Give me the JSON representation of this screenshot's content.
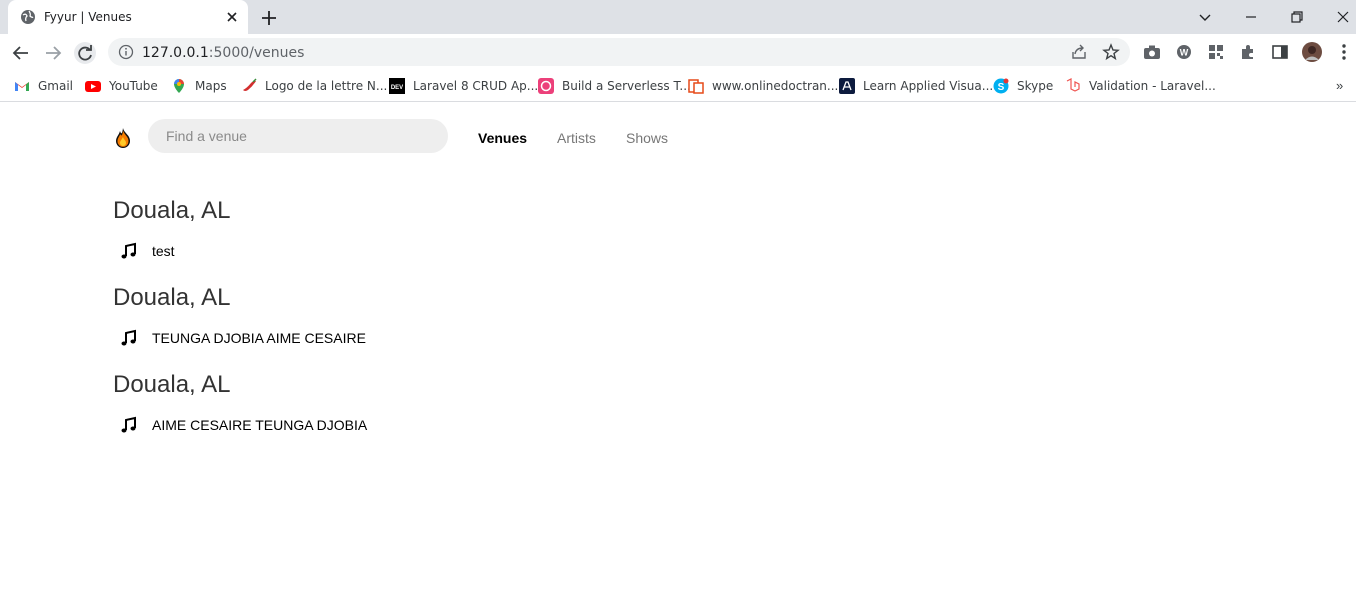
{
  "browser": {
    "tab": {
      "title": "Fyyur | Venues"
    },
    "address": {
      "host": "127.0.0.1",
      "path": ":5000/venues"
    },
    "bookmarks": [
      {
        "label": "Gmail",
        "icon": "gmail-icon"
      },
      {
        "label": "YouTube",
        "icon": "youtube-icon"
      },
      {
        "label": "Maps",
        "icon": "maps-icon"
      },
      {
        "label": "Logo de la lettre N...",
        "icon": "chili-icon"
      },
      {
        "label": "Laravel 8 CRUD Ap...",
        "icon": "dev-icon"
      },
      {
        "label": "Build a Serverless T...",
        "icon": "pink-square-icon"
      },
      {
        "label": "www.onlinedoctran...",
        "icon": "doc-translate-icon"
      },
      {
        "label": "Learn Applied Visua...",
        "icon": "angular-icon"
      },
      {
        "label": "Skype",
        "icon": "skype-icon"
      },
      {
        "label": "Validation - Laravel...",
        "icon": "laravel-icon"
      }
    ],
    "bookmarks_more": "»"
  },
  "header": {
    "search_placeholder": "Find a venue",
    "nav": [
      {
        "label": "Venues",
        "active": true
      },
      {
        "label": "Artists",
        "active": false
      },
      {
        "label": "Shows",
        "active": false
      }
    ]
  },
  "areas": [
    {
      "city": "Douala, AL",
      "venues": [
        {
          "name": "test"
        }
      ]
    },
    {
      "city": "Douala, AL",
      "venues": [
        {
          "name": "TEUNGA DJOBIA AIME CESAIRE"
        }
      ]
    },
    {
      "city": "Douala, AL",
      "venues": [
        {
          "name": "AIME CESAIRE TEUNGA DJOBIA"
        }
      ]
    }
  ]
}
